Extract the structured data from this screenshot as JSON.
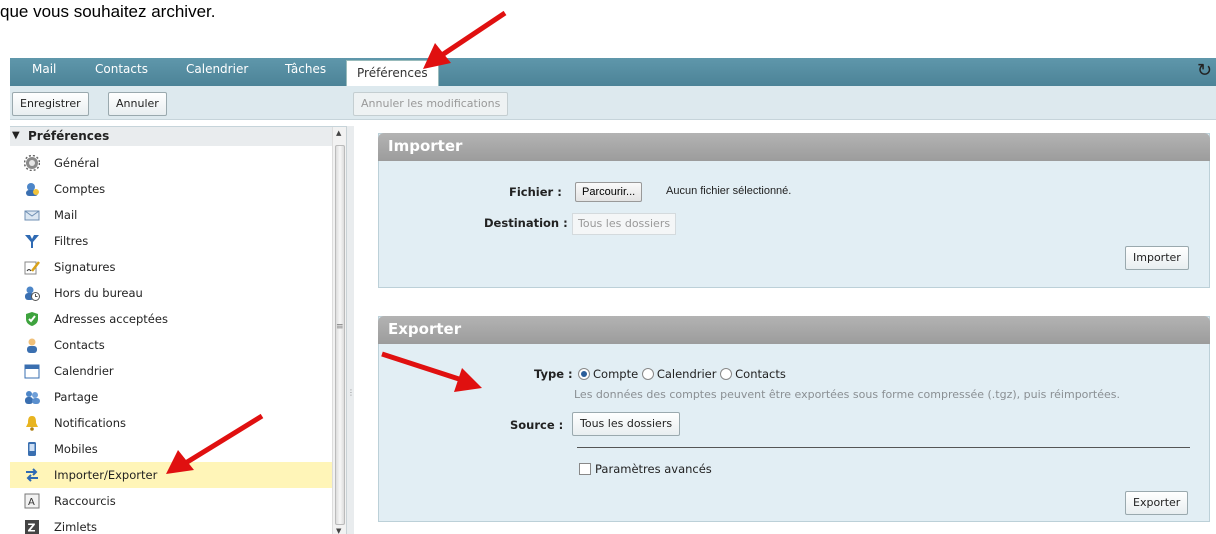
{
  "doc_text": "que vous souhaitez archiver.",
  "tabs": {
    "mail": "Mail",
    "contacts": "Contacts",
    "calendrier": "Calendrier",
    "taches": "Tâches",
    "preferences": "Préférences"
  },
  "toolbar": {
    "enregistrer": "Enregistrer",
    "annuler": "Annuler",
    "annuler_modifs": "Annuler les modifications"
  },
  "sidebar": {
    "header": "Préférences",
    "items": [
      "Général",
      "Comptes",
      "Mail",
      "Filtres",
      "Signatures",
      "Hors du bureau",
      "Adresses acceptées",
      "Contacts",
      "Calendrier",
      "Partage",
      "Notifications",
      "Mobiles",
      "Importer/Exporter",
      "Raccourcis",
      "Zimlets"
    ]
  },
  "importer": {
    "title": "Importer",
    "fichier_label": "Fichier :",
    "browse": "Parcourir...",
    "no_file": "Aucun fichier sélectionné.",
    "destination_label": "Destination :",
    "destination_value": "Tous les dossiers",
    "button": "Importer"
  },
  "exporter": {
    "title": "Exporter",
    "type_label": "Type :",
    "types": [
      "Compte",
      "Calendrier",
      "Contacts"
    ],
    "hint": "Les données des comptes peuvent être exportées sous forme compressée (.tgz), puis réimportées.",
    "source_label": "Source :",
    "source_value": "Tous les dossiers",
    "advanced": "Paramètres avancés",
    "button": "Exporter"
  },
  "colors": {
    "tabbar": "#5f97ab",
    "panel_bg": "#e2eef4",
    "panel_head": "#a8a8a8",
    "selection": "#fff5b8",
    "arrow": "#e01010"
  }
}
